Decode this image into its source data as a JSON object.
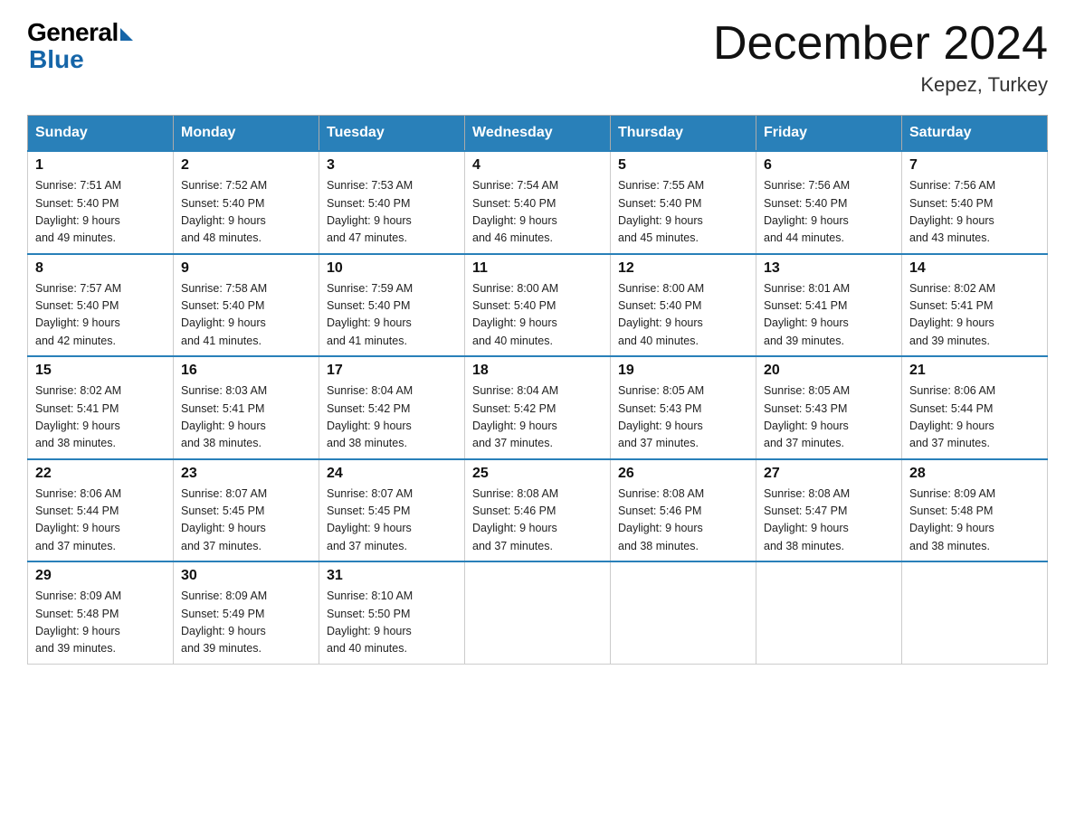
{
  "logo": {
    "general": "General",
    "blue": "Blue"
  },
  "title": "December 2024",
  "subtitle": "Kepez, Turkey",
  "days_of_week": [
    "Sunday",
    "Monday",
    "Tuesday",
    "Wednesday",
    "Thursday",
    "Friday",
    "Saturday"
  ],
  "weeks": [
    [
      {
        "day": "1",
        "sunrise": "7:51 AM",
        "sunset": "5:40 PM",
        "daylight": "9 hours and 49 minutes."
      },
      {
        "day": "2",
        "sunrise": "7:52 AM",
        "sunset": "5:40 PM",
        "daylight": "9 hours and 48 minutes."
      },
      {
        "day": "3",
        "sunrise": "7:53 AM",
        "sunset": "5:40 PM",
        "daylight": "9 hours and 47 minutes."
      },
      {
        "day": "4",
        "sunrise": "7:54 AM",
        "sunset": "5:40 PM",
        "daylight": "9 hours and 46 minutes."
      },
      {
        "day": "5",
        "sunrise": "7:55 AM",
        "sunset": "5:40 PM",
        "daylight": "9 hours and 45 minutes."
      },
      {
        "day": "6",
        "sunrise": "7:56 AM",
        "sunset": "5:40 PM",
        "daylight": "9 hours and 44 minutes."
      },
      {
        "day": "7",
        "sunrise": "7:56 AM",
        "sunset": "5:40 PM",
        "daylight": "9 hours and 43 minutes."
      }
    ],
    [
      {
        "day": "8",
        "sunrise": "7:57 AM",
        "sunset": "5:40 PM",
        "daylight": "9 hours and 42 minutes."
      },
      {
        "day": "9",
        "sunrise": "7:58 AM",
        "sunset": "5:40 PM",
        "daylight": "9 hours and 41 minutes."
      },
      {
        "day": "10",
        "sunrise": "7:59 AM",
        "sunset": "5:40 PM",
        "daylight": "9 hours and 41 minutes."
      },
      {
        "day": "11",
        "sunrise": "8:00 AM",
        "sunset": "5:40 PM",
        "daylight": "9 hours and 40 minutes."
      },
      {
        "day": "12",
        "sunrise": "8:00 AM",
        "sunset": "5:40 PM",
        "daylight": "9 hours and 40 minutes."
      },
      {
        "day": "13",
        "sunrise": "8:01 AM",
        "sunset": "5:41 PM",
        "daylight": "9 hours and 39 minutes."
      },
      {
        "day": "14",
        "sunrise": "8:02 AM",
        "sunset": "5:41 PM",
        "daylight": "9 hours and 39 minutes."
      }
    ],
    [
      {
        "day": "15",
        "sunrise": "8:02 AM",
        "sunset": "5:41 PM",
        "daylight": "9 hours and 38 minutes."
      },
      {
        "day": "16",
        "sunrise": "8:03 AM",
        "sunset": "5:41 PM",
        "daylight": "9 hours and 38 minutes."
      },
      {
        "day": "17",
        "sunrise": "8:04 AM",
        "sunset": "5:42 PM",
        "daylight": "9 hours and 38 minutes."
      },
      {
        "day": "18",
        "sunrise": "8:04 AM",
        "sunset": "5:42 PM",
        "daylight": "9 hours and 37 minutes."
      },
      {
        "day": "19",
        "sunrise": "8:05 AM",
        "sunset": "5:43 PM",
        "daylight": "9 hours and 37 minutes."
      },
      {
        "day": "20",
        "sunrise": "8:05 AM",
        "sunset": "5:43 PM",
        "daylight": "9 hours and 37 minutes."
      },
      {
        "day": "21",
        "sunrise": "8:06 AM",
        "sunset": "5:44 PM",
        "daylight": "9 hours and 37 minutes."
      }
    ],
    [
      {
        "day": "22",
        "sunrise": "8:06 AM",
        "sunset": "5:44 PM",
        "daylight": "9 hours and 37 minutes."
      },
      {
        "day": "23",
        "sunrise": "8:07 AM",
        "sunset": "5:45 PM",
        "daylight": "9 hours and 37 minutes."
      },
      {
        "day": "24",
        "sunrise": "8:07 AM",
        "sunset": "5:45 PM",
        "daylight": "9 hours and 37 minutes."
      },
      {
        "day": "25",
        "sunrise": "8:08 AM",
        "sunset": "5:46 PM",
        "daylight": "9 hours and 37 minutes."
      },
      {
        "day": "26",
        "sunrise": "8:08 AM",
        "sunset": "5:46 PM",
        "daylight": "9 hours and 38 minutes."
      },
      {
        "day": "27",
        "sunrise": "8:08 AM",
        "sunset": "5:47 PM",
        "daylight": "9 hours and 38 minutes."
      },
      {
        "day": "28",
        "sunrise": "8:09 AM",
        "sunset": "5:48 PM",
        "daylight": "9 hours and 38 minutes."
      }
    ],
    [
      {
        "day": "29",
        "sunrise": "8:09 AM",
        "sunset": "5:48 PM",
        "daylight": "9 hours and 39 minutes."
      },
      {
        "day": "30",
        "sunrise": "8:09 AM",
        "sunset": "5:49 PM",
        "daylight": "9 hours and 39 minutes."
      },
      {
        "day": "31",
        "sunrise": "8:10 AM",
        "sunset": "5:50 PM",
        "daylight": "9 hours and 40 minutes."
      },
      null,
      null,
      null,
      null
    ]
  ]
}
